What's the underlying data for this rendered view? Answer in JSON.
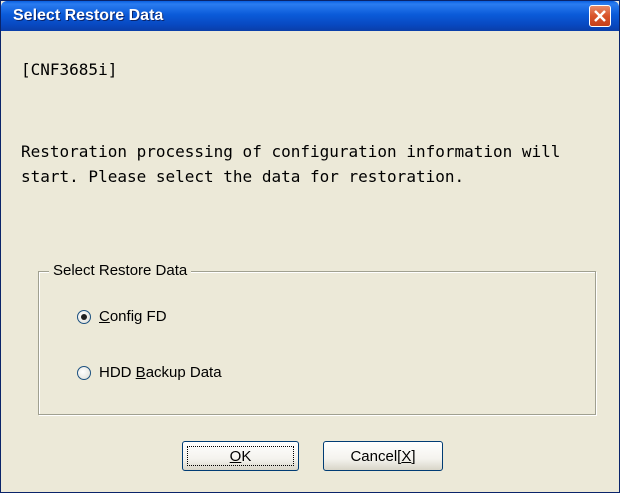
{
  "window": {
    "title": "Select Restore Data",
    "close_icon": "close-icon"
  },
  "content": {
    "device": "[CNF3685i]",
    "message_line1": "Restoration processing of configuration information will",
    "message_line2": "start. Please select the data for restoration."
  },
  "group": {
    "legend": "Select Restore Data",
    "options": [
      {
        "prefix": "",
        "mnemonic": "C",
        "rest": "onfig FD",
        "selected": true
      },
      {
        "prefix": "HDD ",
        "mnemonic": "B",
        "rest": "ackup Data",
        "selected": false
      }
    ]
  },
  "buttons": {
    "ok_mnemonic": "O",
    "ok_rest": "K",
    "cancel_prefix": "Cancel[",
    "cancel_mnemonic": "X",
    "cancel_suffix": "]"
  },
  "colors": {
    "titlebar": "#0b5bd9",
    "close": "#d9542b",
    "face": "#ece9d8"
  }
}
